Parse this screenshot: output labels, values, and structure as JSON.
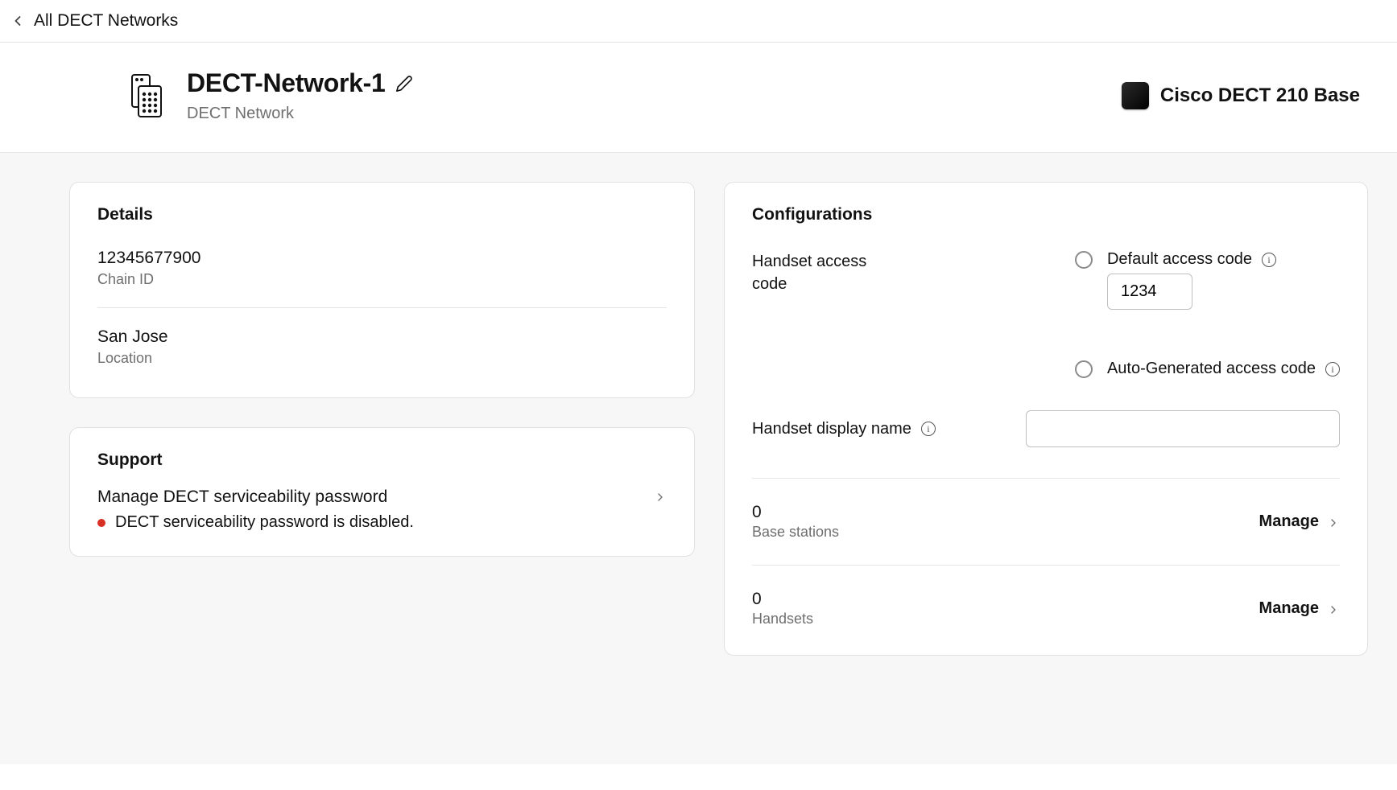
{
  "breadcrumb": {
    "back_label": "All DECT Networks"
  },
  "header": {
    "title": "DECT-Network-1",
    "subtitle": "DECT Network",
    "product_name": "Cisco DECT 210 Base"
  },
  "details": {
    "card_title": "Details",
    "chain_id": {
      "value": "12345677900",
      "label": "Chain ID"
    },
    "location": {
      "value": "San Jose",
      "label": "Location"
    }
  },
  "support": {
    "card_title": "Support",
    "manage_label": "Manage DECT serviceability password",
    "status_text": "DECT serviceability password is disabled."
  },
  "configurations": {
    "card_title": "Configurations",
    "handset_access_code_label": "Handset access code",
    "default_code": {
      "label": "Default access code",
      "value": "1234"
    },
    "auto_code": {
      "label": "Auto-Generated access code"
    },
    "display_name_label": "Handset display name",
    "display_name_value": "",
    "base_stations": {
      "value": "0",
      "label": "Base stations",
      "action": "Manage"
    },
    "handsets": {
      "value": "0",
      "label": "Handsets",
      "action": "Manage"
    }
  }
}
